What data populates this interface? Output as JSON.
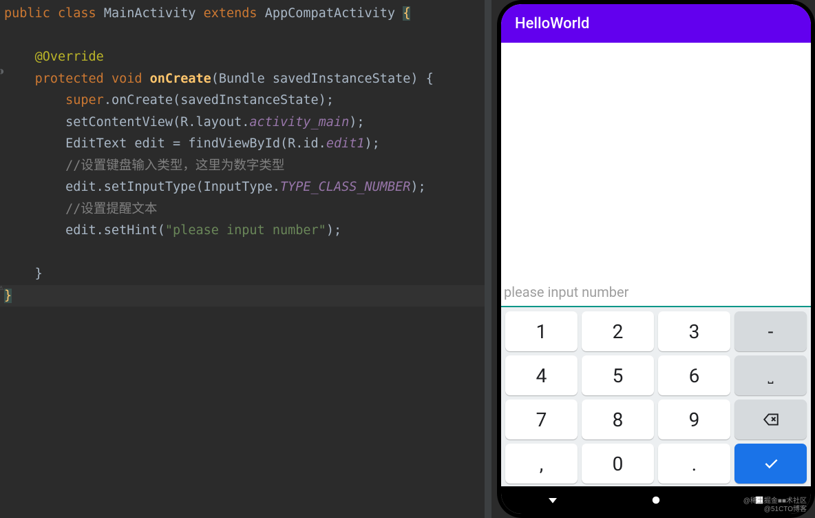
{
  "code": {
    "tokens": {
      "public": "public",
      "class_kw": "class",
      "class_name": "MainActivity",
      "extends": "extends",
      "super_class": "AppCompatActivity",
      "lbrace": "{",
      "override": "@Override",
      "protected": "protected",
      "void": "void",
      "onCreate": "onCreate",
      "params": "(Bundle savedInstanceState) {",
      "super_call_pre": "super",
      "super_call_dot": ".onCreate(savedInstanceState);",
      "setContentView": "setContentView(R.layout.",
      "activity_main": "activity_main",
      "close_paren": ");",
      "editText": "EditText edit = findViewById(R.id.",
      "edit1": "edit1",
      "comment1": "//设置键盘输入类型，这里为数字类型",
      "setInputType_pre": "edit.setInputType(InputType.",
      "type_class_number": "TYPE_CLASS_NUMBER",
      "comment2": "//设置提醒文本",
      "setHint_pre": "edit.setHint(",
      "hint_str": "\"please input number\"",
      "rbrace": "}"
    }
  },
  "phone": {
    "app_title": "HelloWorld",
    "placeholder": "please input number",
    "keys": {
      "r1c1": "1",
      "r1c2": "2",
      "r1c3": "3",
      "r1c4": "-",
      "r2c1": "4",
      "r2c2": "5",
      "r2c3": "6",
      "r2c4": "␣",
      "r3c1": "7",
      "r3c2": "8",
      "r3c3": "9",
      "r4c1": ",",
      "r4c2": "0",
      "r4c3": "."
    }
  },
  "watermark": {
    "line1": "@稀土掘金■■术社区",
    "line2": "@51CTO博客"
  }
}
